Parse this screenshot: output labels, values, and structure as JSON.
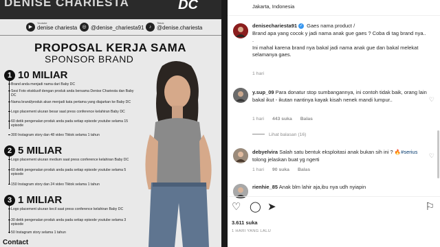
{
  "image": {
    "banner_name": "DENISE CHARIESTA",
    "banner_logo": "DC",
    "socials": [
      {
        "platform": "Youtube",
        "handle": "denise chariesta",
        "icon": "youtube-icon"
      },
      {
        "platform": "",
        "handle": "@denise_chariesta91",
        "icon": "instagram-icon"
      },
      {
        "platform": "Tiktok",
        "handle": "@denise.chariesta",
        "icon": "tiktok-icon"
      }
    ],
    "title": "PROPOSAL KERJA SAMA",
    "subtitle": "SPONSOR BRAND",
    "tiers": [
      {
        "num": "1",
        "amount": "10 MILIAR",
        "items": [
          "Brand anda menjadi nama dari Baby DC",
          "Sesi Foto eksklusif dengan produk anda bersama Denise Chariesta dan Baby DC",
          "Nama brand/produk akan menjadi kata pertama yang diajarkan ke Baby DC",
          "Logo placement ukuran besar saat press conference kelahiran Baby DC",
          "60 detik pengenalan produk anda pada setiap episode youtube selama 15 episode",
          "300 Instagram story dan 48 video Tiktok selama 1 tahun"
        ]
      },
      {
        "num": "2",
        "amount": "5 MILIAR",
        "items": [
          "Logo placement ukuran medium saat press conference kelahiran Baby DC",
          "60 detik pengenalan produk anda pada setiap episode youtube selama 5 episode",
          "150 Instagram story dan 24 video Tiktok selama 1 tahun"
        ]
      },
      {
        "num": "3",
        "amount": "1 MILIAR",
        "items": [
          "Logo placement ukuran kecil saat press conference kelahiran Baby DC",
          "30 detik pengenalan produk anda pada setiap episode youtube selama 3 episode",
          "50 Instagram story selama 1 tahun"
        ]
      }
    ],
    "contact": "Contact"
  },
  "post": {
    "location": "Jakarta, Indonesia",
    "caption": {
      "user": "denisechariesta91",
      "lines": [
        "Gaes nama product /",
        "Brand apa yang cocok y jadi nama anak gue gaes ? Coba di tag brand nya..",
        ".",
        "Ini mahal karena brand nya bakal jadi nama anak gue dan bakal melekat selamanya gaes."
      ],
      "time": "1 hari"
    },
    "comments": [
      {
        "user": "y.sup_09",
        "text": "Para donatur stop sumbangannya, ini contoh tidak baik, orang lain bakal ikut - ikutan nantinya kayak kisah nenek mandi lumpur..",
        "time": "1 hari",
        "likes": "443 suka",
        "reply": "Balas"
      },
      {
        "user": "debyelvira",
        "text_before": "Salah satu bentuk eksploitasi anak bukan sih ini ? 🔥",
        "hashtag": "#serius",
        "text_after": " tolong jelaskan buat yg ngerti",
        "time": "1 hari",
        "likes": "90 suka",
        "reply": "Balas"
      },
      {
        "user": "rienhie_85",
        "text": "Anak blm lahir aja,ibu nya udh nyiapin",
        "time": "",
        "likes": "",
        "reply": ""
      }
    ],
    "view_replies": "Lihat balasan (16)",
    "likes_count": "3.611 suka",
    "time_ago": "1 HARI YANG LALU"
  }
}
